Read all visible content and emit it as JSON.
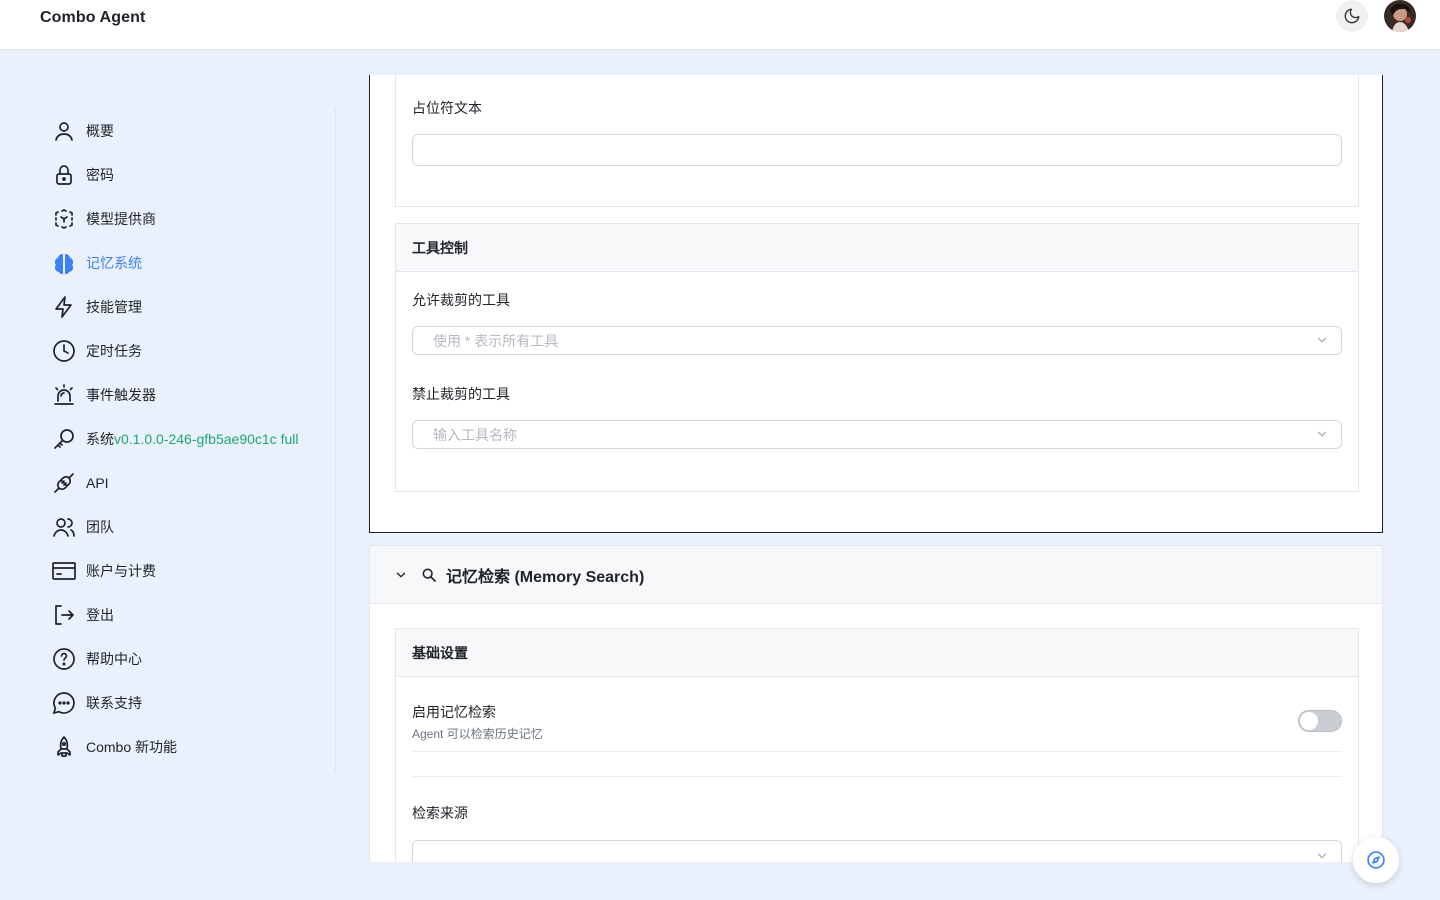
{
  "header": {
    "brand": "Combo Agent"
  },
  "sidebar": {
    "items": [
      {
        "label": "概要",
        "icon": "user-icon"
      },
      {
        "label": "密码",
        "icon": "lock-icon"
      },
      {
        "label": "模型提供商",
        "icon": "cube-icon"
      },
      {
        "label": "记忆系统",
        "icon": "brain-icon",
        "active": true
      },
      {
        "label": "技能管理",
        "icon": "bolt-icon"
      },
      {
        "label": "定时任务",
        "icon": "clock-icon"
      },
      {
        "label": "事件触发器",
        "icon": "alarm-icon"
      },
      {
        "label": "系统",
        "icon": "key-icon",
        "version": "v0.1.0.0-246-gfb5ae90c1c full"
      },
      {
        "label": "API",
        "icon": "plug-icon"
      },
      {
        "label": "团队",
        "icon": "team-icon"
      },
      {
        "label": "账户与计费",
        "icon": "card-icon"
      },
      {
        "label": "登出",
        "icon": "logout-icon"
      },
      {
        "label": "帮助中心",
        "icon": "help-icon"
      },
      {
        "label": "联系支持",
        "icon": "chat-icon"
      },
      {
        "label": "Combo 新功能",
        "icon": "rocket-icon"
      }
    ]
  },
  "main": {
    "placeholder_field": {
      "label": "占位符文本",
      "value": ""
    },
    "tool_control": {
      "title": "工具控制",
      "allowed_label": "允许裁剪的工具",
      "allowed_placeholder": "使用 * 表示所有工具",
      "denied_label": "禁止裁剪的工具",
      "denied_placeholder": "输入工具名称"
    },
    "memory_search": {
      "title": "记忆检索 (Memory Search)",
      "basic_title": "基础设置",
      "enable_label": "启用记忆检索",
      "enable_hint": "Agent 可以检索历史记忆",
      "enabled": false,
      "source_label": "检索来源"
    }
  },
  "colors": {
    "accent": "#3b82f6",
    "version": "#19a974",
    "background": "#eaf1fd"
  }
}
